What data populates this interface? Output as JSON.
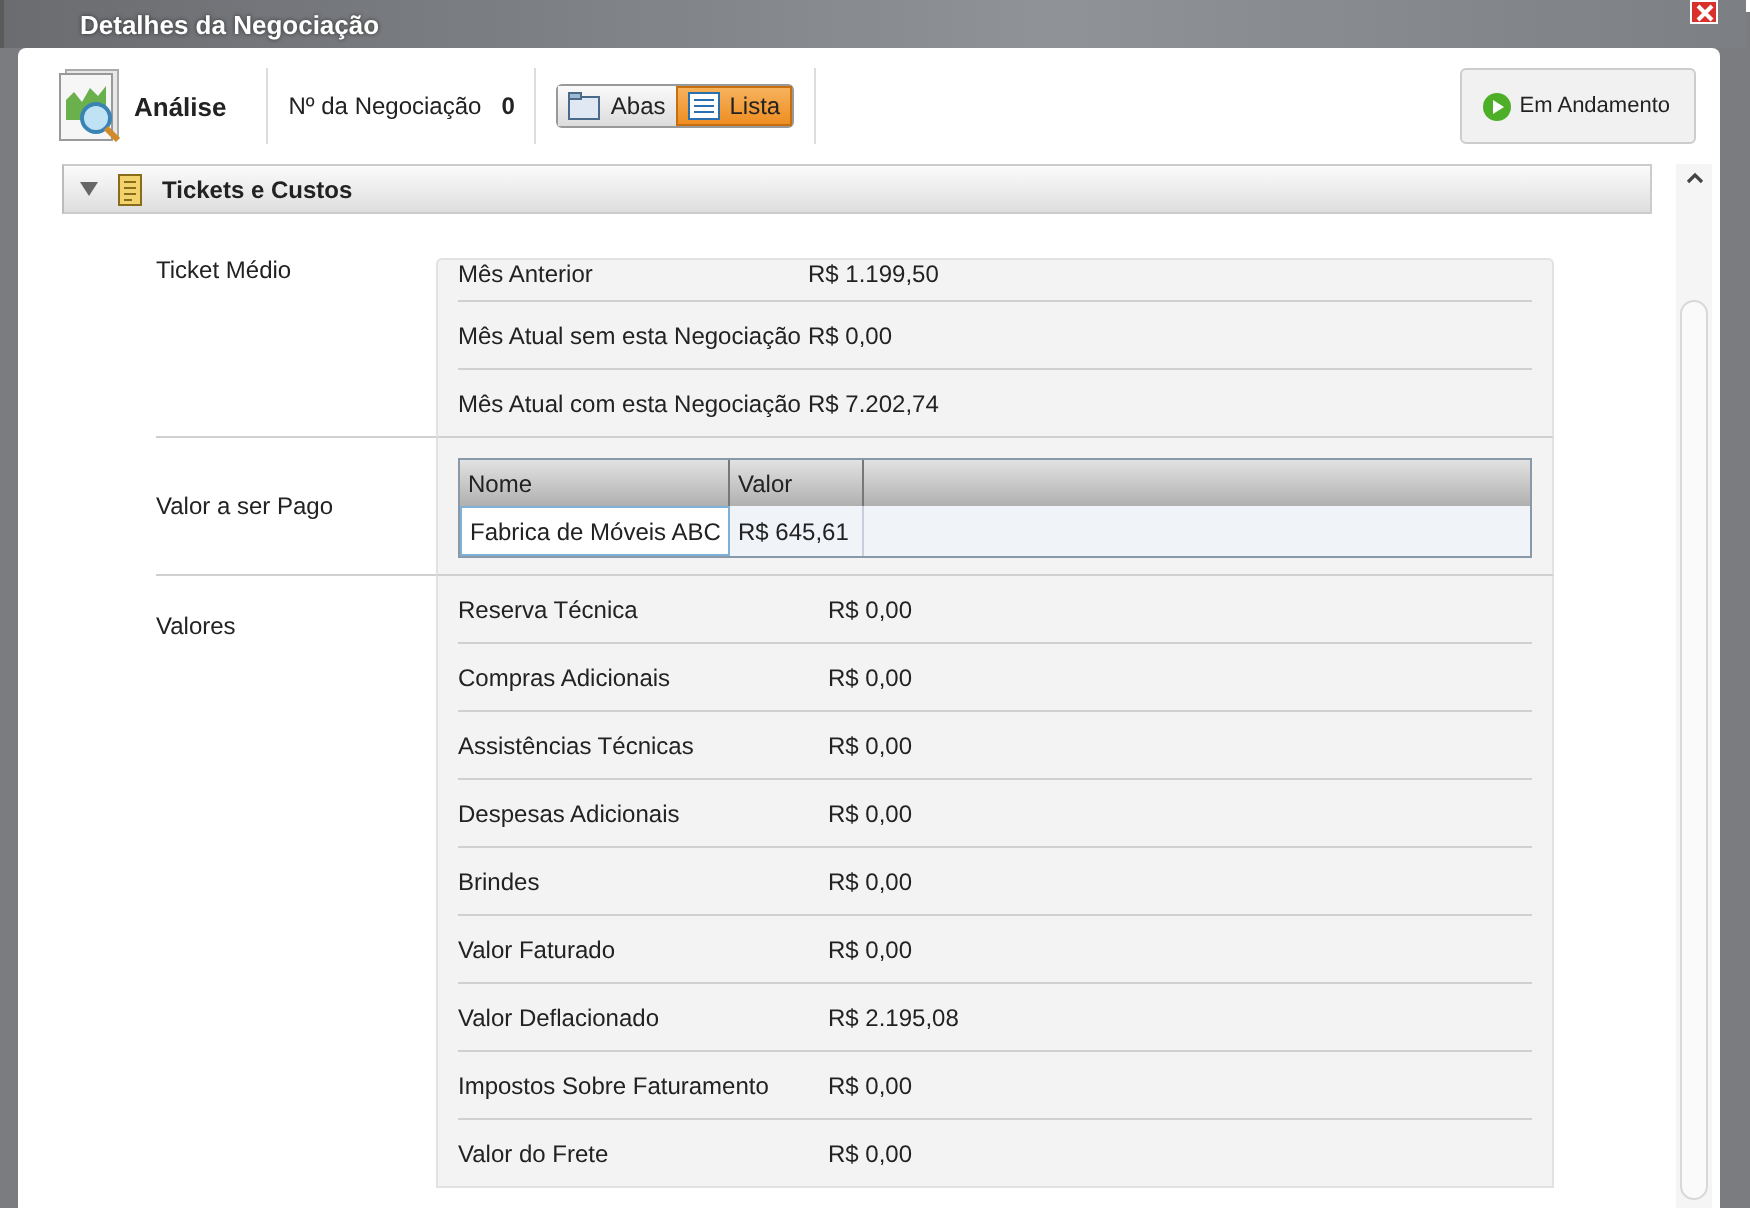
{
  "window": {
    "title": "Detalhes da Negociação"
  },
  "toolbar": {
    "title": "Análise",
    "negotiation_label": "Nº da Negociação",
    "negotiation_number": "0",
    "view_toggle": [
      {
        "label": "Abas",
        "selected": false
      },
      {
        "label": "Lista",
        "selected": true
      }
    ],
    "status_button": "Em Andamento"
  },
  "section": {
    "title": "Tickets e Custos",
    "expanded": true
  },
  "groups": [
    {
      "kind": "rows",
      "label": "Ticket Médio",
      "rows": [
        {
          "label": "Mês Anterior",
          "value": "R$ 1.199,50"
        },
        {
          "label": "Mês Atual sem esta Negociação",
          "value": "R$ 0,00"
        },
        {
          "label": "Mês Atual com esta Negociação",
          "value": "R$ 7.202,74"
        }
      ]
    },
    {
      "kind": "table",
      "label": "Valor a ser Pago",
      "table": {
        "columns": [
          "Nome",
          "Valor"
        ],
        "rows": [
          [
            "Fabrica de Móveis ABC",
            "R$ 645,61"
          ]
        ]
      }
    },
    {
      "kind": "rows",
      "label": "Valores",
      "rows": [
        {
          "label": "Reserva Técnica",
          "value": "R$ 0,00"
        },
        {
          "label": "Compras Adicionais",
          "value": "R$ 0,00"
        },
        {
          "label": "Assistências Técnicas",
          "value": "R$ 0,00"
        },
        {
          "label": "Despesas Adicionais",
          "value": "R$ 0,00"
        },
        {
          "label": "Brindes",
          "value": "R$ 0,00"
        },
        {
          "label": "Valor Faturado",
          "value": "R$ 0,00"
        },
        {
          "label": "Valor Deflacionado",
          "value": "R$ 2.195,08"
        },
        {
          "label": "Impostos Sobre Faturamento",
          "value": "R$ 0,00"
        },
        {
          "label": "Valor do Frete",
          "value": "R$ 0,00"
        }
      ]
    }
  ]
}
